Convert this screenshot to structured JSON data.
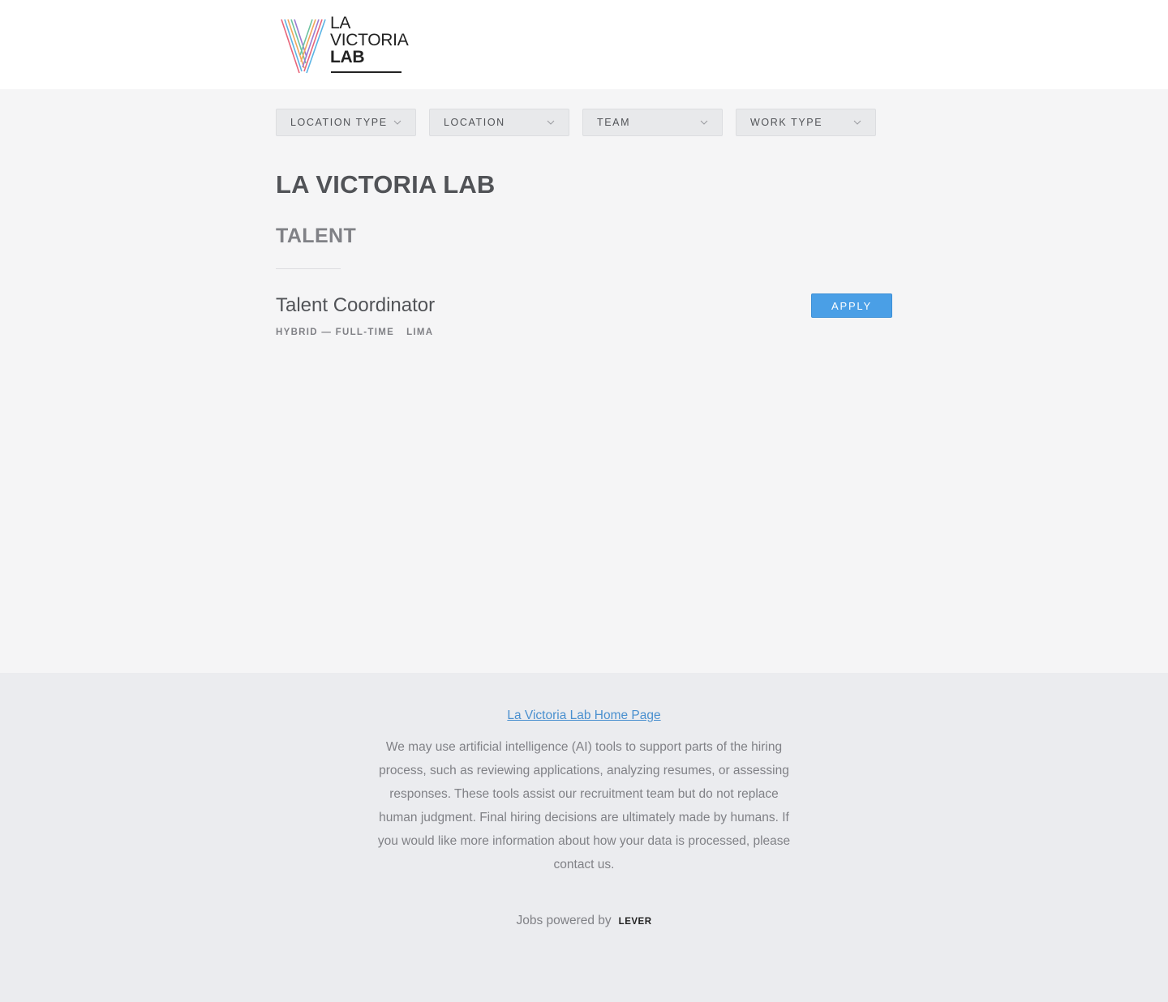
{
  "header": {
    "logo": {
      "line1": "LA",
      "line2": "VICTORIA",
      "line3": "LAB"
    }
  },
  "filters": [
    {
      "label": "LOCATION TYPE"
    },
    {
      "label": "LOCATION"
    },
    {
      "label": "TEAM"
    },
    {
      "label": "WORK TYPE"
    }
  ],
  "company": {
    "title": "LA VICTORIA LAB"
  },
  "team": {
    "title": "TALENT"
  },
  "posting": {
    "title": "Talent Coordinator",
    "meta": [
      "HYBRID — FULL-TIME",
      "LIMA"
    ],
    "apply_label": "APPLY"
  },
  "footer": {
    "home_link": "La Victoria Lab Home Page",
    "ai_notice": "We may use artificial intelligence (AI) tools to support parts of the hiring process, such as reviewing applications, analyzing resumes, or assessing responses. These tools assist our recruitment team but do not replace human judgment. Final hiring decisions are ultimately made by humans. If you would like more information about how your data is processed, please contact us.",
    "powered_by": "Jobs powered by",
    "lever": "LEVER"
  },
  "colors": {
    "accent": "#4a9fe6",
    "link": "#4a90cf",
    "text": "#515357",
    "muted": "#808186"
  }
}
